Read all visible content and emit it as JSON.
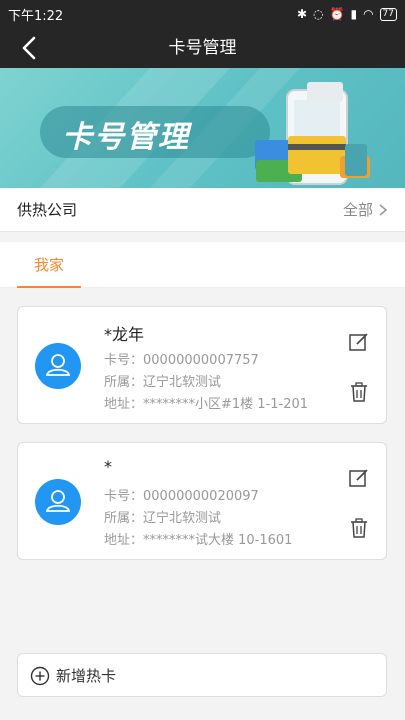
{
  "status_bar": {
    "time": "下午1:22",
    "battery": "77"
  },
  "nav": {
    "title": "卡号管理",
    "back_icon": "chevron-left-icon"
  },
  "banner": {
    "title": "卡号管理"
  },
  "company": {
    "label": "供热公司",
    "value": "全部"
  },
  "tabs": [
    {
      "label": "我家",
      "active": true
    }
  ],
  "cards": [
    {
      "name": "*龙年",
      "card_no": "卡号：00000000007757",
      "belongs": "所属：辽宁北软测试",
      "address": "地址：********小区#1楼 1-1-201"
    },
    {
      "name": "*",
      "card_no": "卡号：00000000020097",
      "belongs": "所属：辽宁北软测试",
      "address": "地址：********试大楼 10-1601"
    }
  ],
  "add_card": {
    "label": "新增热卡"
  },
  "colors": {
    "accent": "#f08a2c",
    "avatar": "#2196f3",
    "bar": "#262626",
    "banner": "#5fc2c6"
  }
}
